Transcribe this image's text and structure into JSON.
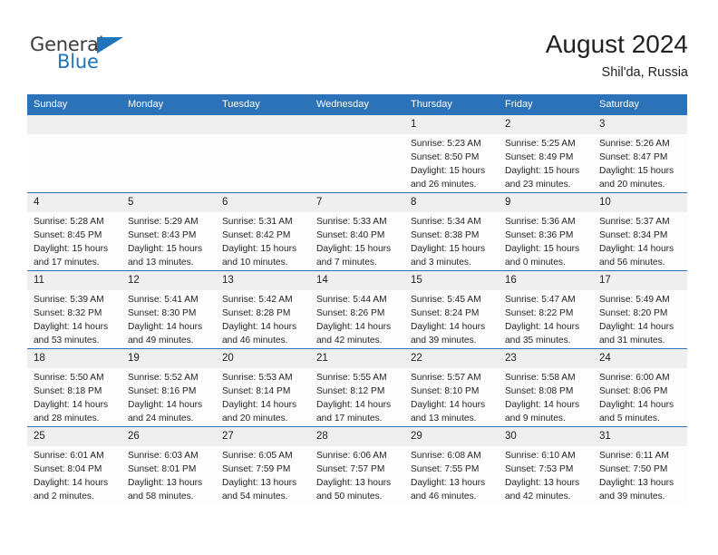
{
  "brand": {
    "name_part1": "General",
    "name_part2": "Blue",
    "triangle_color": "#1f74bb"
  },
  "header": {
    "title": "August 2024",
    "subtitle": "Shil'da, Russia"
  },
  "theme": {
    "header_blue": "#2b72b8",
    "daynum_band": "#efefef",
    "cell_bg": "#fdfdfd",
    "text": "#231f20"
  },
  "weekdays": [
    "Sunday",
    "Monday",
    "Tuesday",
    "Wednesday",
    "Thursday",
    "Friday",
    "Saturday"
  ],
  "weeks": [
    [
      {
        "day": ""
      },
      {
        "day": ""
      },
      {
        "day": ""
      },
      {
        "day": ""
      },
      {
        "day": "1",
        "sunrise": "Sunrise: 5:23 AM",
        "sunset": "Sunset: 8:50 PM",
        "daylight1": "Daylight: 15 hours",
        "daylight2": "and 26 minutes."
      },
      {
        "day": "2",
        "sunrise": "Sunrise: 5:25 AM",
        "sunset": "Sunset: 8:49 PM",
        "daylight1": "Daylight: 15 hours",
        "daylight2": "and 23 minutes."
      },
      {
        "day": "3",
        "sunrise": "Sunrise: 5:26 AM",
        "sunset": "Sunset: 8:47 PM",
        "daylight1": "Daylight: 15 hours",
        "daylight2": "and 20 minutes."
      }
    ],
    [
      {
        "day": "4",
        "sunrise": "Sunrise: 5:28 AM",
        "sunset": "Sunset: 8:45 PM",
        "daylight1": "Daylight: 15 hours",
        "daylight2": "and 17 minutes."
      },
      {
        "day": "5",
        "sunrise": "Sunrise: 5:29 AM",
        "sunset": "Sunset: 8:43 PM",
        "daylight1": "Daylight: 15 hours",
        "daylight2": "and 13 minutes."
      },
      {
        "day": "6",
        "sunrise": "Sunrise: 5:31 AM",
        "sunset": "Sunset: 8:42 PM",
        "daylight1": "Daylight: 15 hours",
        "daylight2": "and 10 minutes."
      },
      {
        "day": "7",
        "sunrise": "Sunrise: 5:33 AM",
        "sunset": "Sunset: 8:40 PM",
        "daylight1": "Daylight: 15 hours",
        "daylight2": "and 7 minutes."
      },
      {
        "day": "8",
        "sunrise": "Sunrise: 5:34 AM",
        "sunset": "Sunset: 8:38 PM",
        "daylight1": "Daylight: 15 hours",
        "daylight2": "and 3 minutes."
      },
      {
        "day": "9",
        "sunrise": "Sunrise: 5:36 AM",
        "sunset": "Sunset: 8:36 PM",
        "daylight1": "Daylight: 15 hours",
        "daylight2": "and 0 minutes."
      },
      {
        "day": "10",
        "sunrise": "Sunrise: 5:37 AM",
        "sunset": "Sunset: 8:34 PM",
        "daylight1": "Daylight: 14 hours",
        "daylight2": "and 56 minutes."
      }
    ],
    [
      {
        "day": "11",
        "sunrise": "Sunrise: 5:39 AM",
        "sunset": "Sunset: 8:32 PM",
        "daylight1": "Daylight: 14 hours",
        "daylight2": "and 53 minutes."
      },
      {
        "day": "12",
        "sunrise": "Sunrise: 5:41 AM",
        "sunset": "Sunset: 8:30 PM",
        "daylight1": "Daylight: 14 hours",
        "daylight2": "and 49 minutes."
      },
      {
        "day": "13",
        "sunrise": "Sunrise: 5:42 AM",
        "sunset": "Sunset: 8:28 PM",
        "daylight1": "Daylight: 14 hours",
        "daylight2": "and 46 minutes."
      },
      {
        "day": "14",
        "sunrise": "Sunrise: 5:44 AM",
        "sunset": "Sunset: 8:26 PM",
        "daylight1": "Daylight: 14 hours",
        "daylight2": "and 42 minutes."
      },
      {
        "day": "15",
        "sunrise": "Sunrise: 5:45 AM",
        "sunset": "Sunset: 8:24 PM",
        "daylight1": "Daylight: 14 hours",
        "daylight2": "and 39 minutes."
      },
      {
        "day": "16",
        "sunrise": "Sunrise: 5:47 AM",
        "sunset": "Sunset: 8:22 PM",
        "daylight1": "Daylight: 14 hours",
        "daylight2": "and 35 minutes."
      },
      {
        "day": "17",
        "sunrise": "Sunrise: 5:49 AM",
        "sunset": "Sunset: 8:20 PM",
        "daylight1": "Daylight: 14 hours",
        "daylight2": "and 31 minutes."
      }
    ],
    [
      {
        "day": "18",
        "sunrise": "Sunrise: 5:50 AM",
        "sunset": "Sunset: 8:18 PM",
        "daylight1": "Daylight: 14 hours",
        "daylight2": "and 28 minutes."
      },
      {
        "day": "19",
        "sunrise": "Sunrise: 5:52 AM",
        "sunset": "Sunset: 8:16 PM",
        "daylight1": "Daylight: 14 hours",
        "daylight2": "and 24 minutes."
      },
      {
        "day": "20",
        "sunrise": "Sunrise: 5:53 AM",
        "sunset": "Sunset: 8:14 PM",
        "daylight1": "Daylight: 14 hours",
        "daylight2": "and 20 minutes."
      },
      {
        "day": "21",
        "sunrise": "Sunrise: 5:55 AM",
        "sunset": "Sunset: 8:12 PM",
        "daylight1": "Daylight: 14 hours",
        "daylight2": "and 17 minutes."
      },
      {
        "day": "22",
        "sunrise": "Sunrise: 5:57 AM",
        "sunset": "Sunset: 8:10 PM",
        "daylight1": "Daylight: 14 hours",
        "daylight2": "and 13 minutes."
      },
      {
        "day": "23",
        "sunrise": "Sunrise: 5:58 AM",
        "sunset": "Sunset: 8:08 PM",
        "daylight1": "Daylight: 14 hours",
        "daylight2": "and 9 minutes."
      },
      {
        "day": "24",
        "sunrise": "Sunrise: 6:00 AM",
        "sunset": "Sunset: 8:06 PM",
        "daylight1": "Daylight: 14 hours",
        "daylight2": "and 5 minutes."
      }
    ],
    [
      {
        "day": "25",
        "sunrise": "Sunrise: 6:01 AM",
        "sunset": "Sunset: 8:04 PM",
        "daylight1": "Daylight: 14 hours",
        "daylight2": "and 2 minutes."
      },
      {
        "day": "26",
        "sunrise": "Sunrise: 6:03 AM",
        "sunset": "Sunset: 8:01 PM",
        "daylight1": "Daylight: 13 hours",
        "daylight2": "and 58 minutes."
      },
      {
        "day": "27",
        "sunrise": "Sunrise: 6:05 AM",
        "sunset": "Sunset: 7:59 PM",
        "daylight1": "Daylight: 13 hours",
        "daylight2": "and 54 minutes."
      },
      {
        "day": "28",
        "sunrise": "Sunrise: 6:06 AM",
        "sunset": "Sunset: 7:57 PM",
        "daylight1": "Daylight: 13 hours",
        "daylight2": "and 50 minutes."
      },
      {
        "day": "29",
        "sunrise": "Sunrise: 6:08 AM",
        "sunset": "Sunset: 7:55 PM",
        "daylight1": "Daylight: 13 hours",
        "daylight2": "and 46 minutes."
      },
      {
        "day": "30",
        "sunrise": "Sunrise: 6:10 AM",
        "sunset": "Sunset: 7:53 PM",
        "daylight1": "Daylight: 13 hours",
        "daylight2": "and 42 minutes."
      },
      {
        "day": "31",
        "sunrise": "Sunrise: 6:11 AM",
        "sunset": "Sunset: 7:50 PM",
        "daylight1": "Daylight: 13 hours",
        "daylight2": "and 39 minutes."
      }
    ]
  ]
}
